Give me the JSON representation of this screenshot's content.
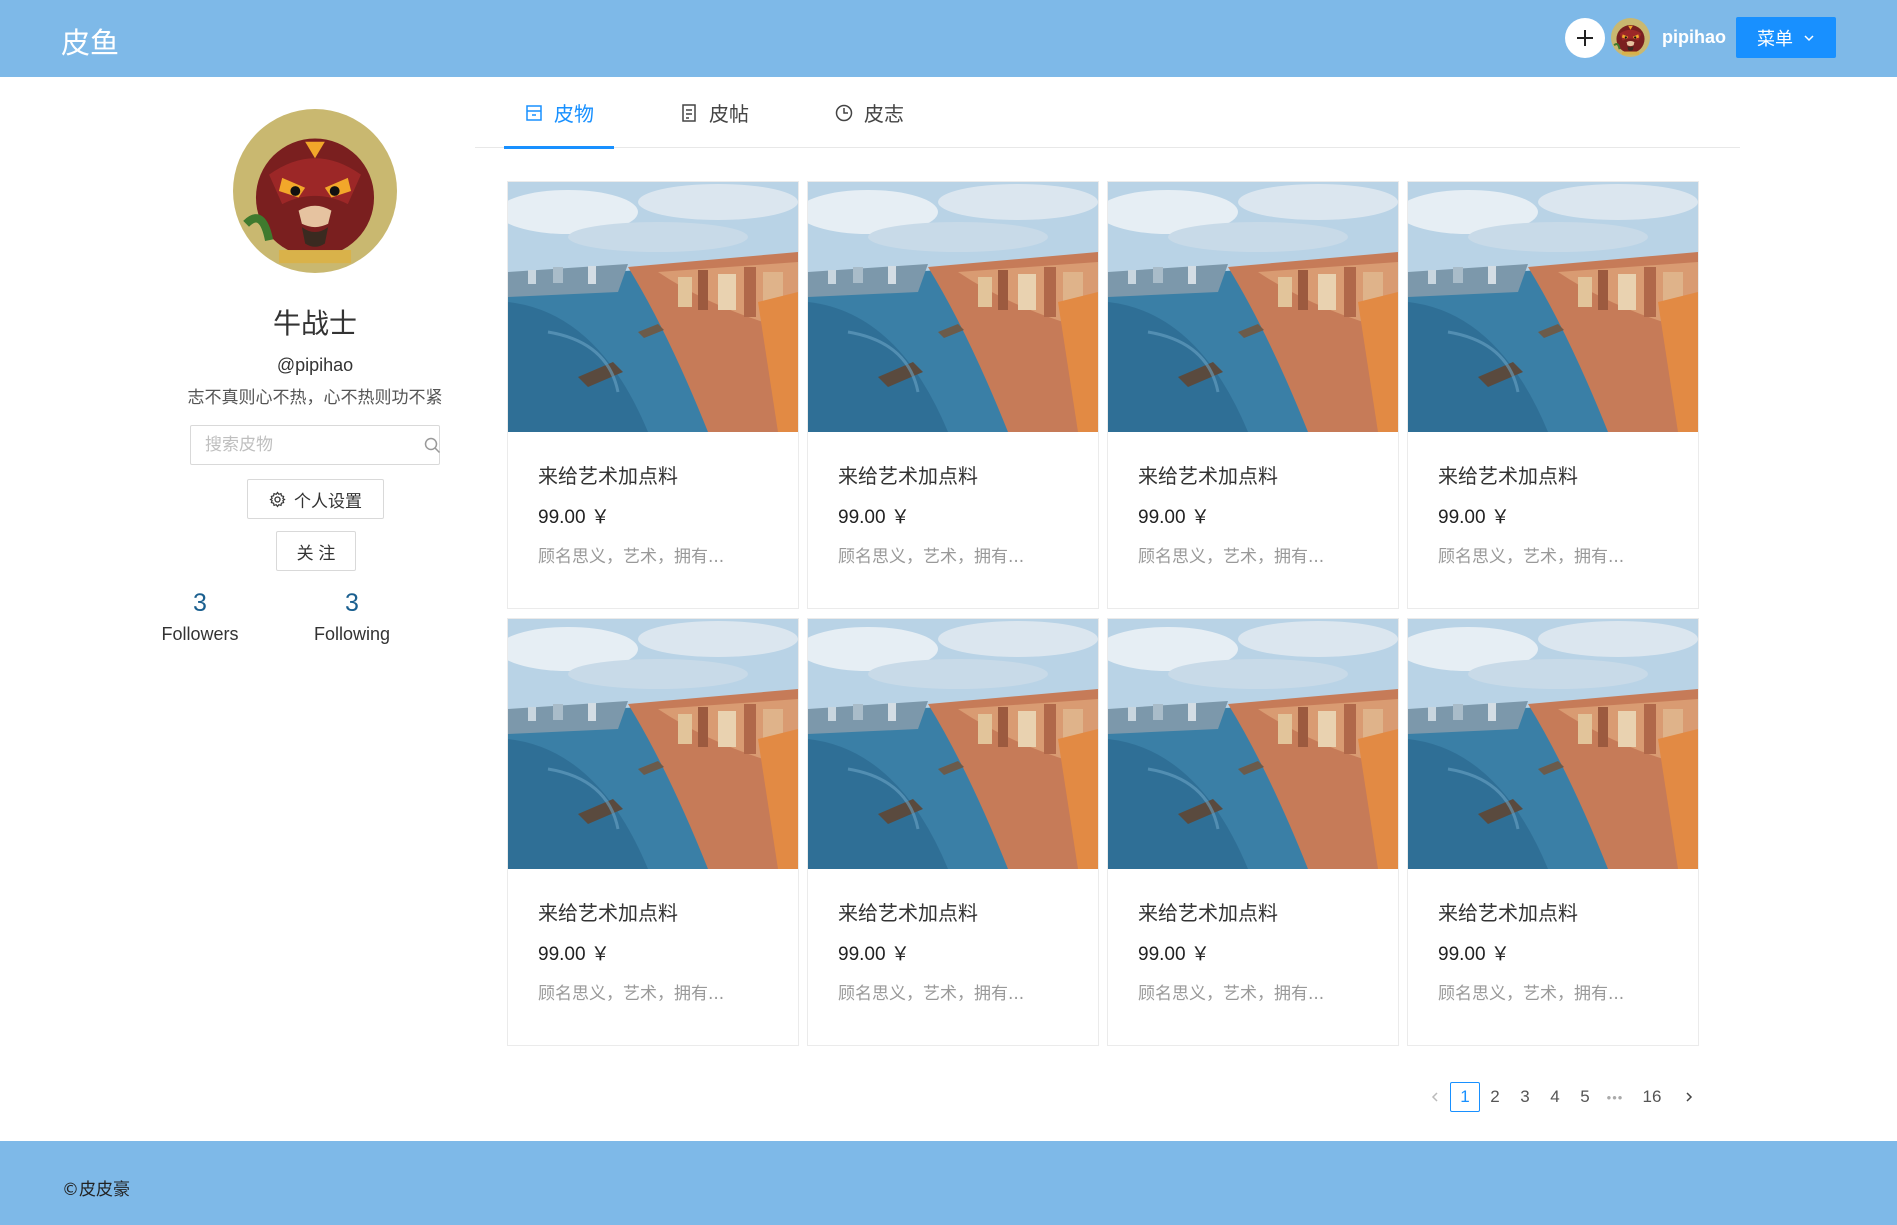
{
  "header": {
    "brand": "皮鱼",
    "username": "pipihao",
    "menu_label": "菜单"
  },
  "profile": {
    "name": "牛战士",
    "handle": "@pipihao",
    "motto": "志不真则心不热，心不热则功不紧",
    "search_placeholder": "搜索皮物",
    "settings_label": "个人设置",
    "follow_label": "关 注",
    "followers_count": "3",
    "followers_label": "Followers",
    "following_count": "3",
    "following_label": "Following"
  },
  "tabs": [
    {
      "label": "皮物",
      "icon": "shop-icon",
      "active": true
    },
    {
      "label": "皮帖",
      "icon": "document-icon",
      "active": false
    },
    {
      "label": "皮志",
      "icon": "clock-icon",
      "active": false
    }
  ],
  "products": [
    {
      "title": "来给艺术加点料",
      "price": "99.00 ￥",
      "desc": "顾名思义，艺术，拥有..."
    },
    {
      "title": "来给艺术加点料",
      "price": "99.00 ￥",
      "desc": "顾名思义，艺术，拥有..."
    },
    {
      "title": "来给艺术加点料",
      "price": "99.00 ￥",
      "desc": "顾名思义，艺术，拥有..."
    },
    {
      "title": "来给艺术加点料",
      "price": "99.00 ￥",
      "desc": "顾名思义，艺术，拥有..."
    },
    {
      "title": "来给艺术加点料",
      "price": "99.00 ￥",
      "desc": "顾名思义，艺术，拥有..."
    },
    {
      "title": "来给艺术加点料",
      "price": "99.00 ￥",
      "desc": "顾名思义，艺术，拥有..."
    },
    {
      "title": "来给艺术加点料",
      "price": "99.00 ￥",
      "desc": "顾名思义，艺术，拥有..."
    },
    {
      "title": "来给艺术加点料",
      "price": "99.00 ￥",
      "desc": "顾名思义，艺术，拥有..."
    }
  ],
  "pagination": {
    "pages": [
      "1",
      "2",
      "3",
      "4",
      "5"
    ],
    "current": "1",
    "ellipsis": "•••",
    "last": "16"
  },
  "footer": {
    "text": "©皮皮豪"
  },
  "colors": {
    "header_bg": "#7eb9e8",
    "accent": "#1890ff",
    "stat_number": "#1a5f8f"
  }
}
